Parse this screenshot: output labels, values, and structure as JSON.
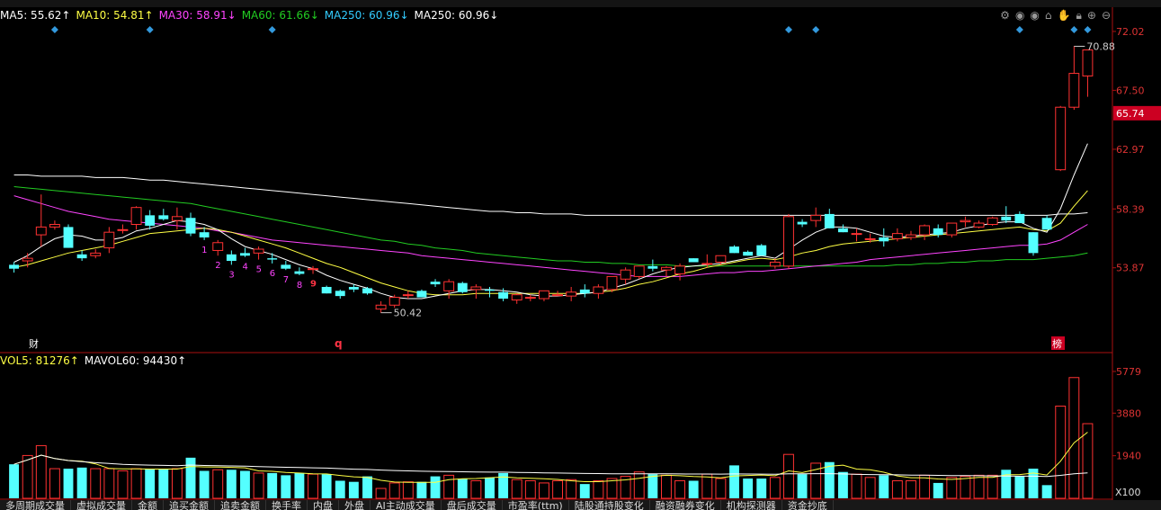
{
  "ma_legend": [
    {
      "label": "MA5: 55.62",
      "arrow": "↑",
      "color": "#ffffff"
    },
    {
      "label": "MA10: 54.81",
      "arrow": "↑",
      "color": "#ffff44"
    },
    {
      "label": "MA30: 58.91",
      "arrow": "↓",
      "color": "#ff44ff"
    },
    {
      "label": "MA60: 61.66",
      "arrow": "↓",
      "color": "#22cc22"
    },
    {
      "label": "MA250: 60.96",
      "arrow": "↓",
      "color": "#33ccff"
    },
    {
      "label": "MA250: 60.96",
      "arrow": "↓",
      "color": "#ffffff"
    }
  ],
  "vol_legend": [
    {
      "label": "VOL5: 81276",
      "arrow": "↑",
      "color": "#ffff44"
    },
    {
      "label": "MAVOL60: 94430",
      "arrow": "↑",
      "color": "#ffffff"
    }
  ],
  "toolbar_icons": [
    "gear-icon",
    "eye-icon",
    "eye-icon",
    "home-icon",
    "hand-icon",
    "lock-icon",
    "zoom-in-icon",
    "zoom-out-icon"
  ],
  "price_axis": {
    "ticks": [
      "72.02",
      "67.50",
      "62.97",
      "58.39",
      "53.87"
    ],
    "current": "65.74",
    "current_bg": "#cc0022"
  },
  "vol_axis": {
    "ticks": [
      "5779",
      "3880",
      "1940"
    ],
    "unit": "X100"
  },
  "annotations": {
    "high": "70.88",
    "low": "50.42",
    "cai": "财",
    "q": "q",
    "bang": "榜"
  },
  "td_counts": [
    "1",
    "2",
    "3",
    "4",
    "5",
    "6",
    "7",
    "8",
    "9"
  ],
  "bottom_tabs": [
    "多周期成交量",
    "虚拟成交量",
    "金额",
    "追买金额",
    "追卖金额",
    "换手率",
    "内盘",
    "外盘",
    "AI主动成交量",
    "盘后成交量",
    "市盈率(ttm)",
    "陆股通持股变化",
    "融资融券变化",
    "机构探测器",
    "资金抄底"
  ],
  "chart_data": {
    "type": "candlestick",
    "ylim": [
      48.6,
      72.5
    ],
    "ohlc": [
      [
        54.1,
        54.3,
        53.5,
        53.8
      ],
      [
        54.4,
        55.0,
        53.9,
        54.6
      ],
      [
        56.4,
        59.5,
        55.5,
        57.0
      ],
      [
        57.0,
        57.5,
        56.8,
        57.2
      ],
      [
        57.0,
        57.2,
        55.4,
        55.4
      ],
      [
        54.9,
        55.2,
        54.4,
        54.6
      ],
      [
        54.8,
        55.3,
        54.6,
        55.0
      ],
      [
        55.4,
        57.0,
        55.0,
        56.6
      ],
      [
        56.8,
        57.2,
        56.5,
        56.8
      ],
      [
        57.2,
        58.6,
        56.8,
        58.5
      ],
      [
        57.9,
        58.3,
        56.8,
        57.1
      ],
      [
        57.9,
        58.4,
        57.5,
        57.6
      ],
      [
        57.5,
        58.5,
        56.8,
        57.8
      ],
      [
        57.7,
        58.1,
        56.3,
        56.5
      ],
      [
        56.6,
        57.0,
        56.0,
        56.2
      ],
      [
        55.2,
        56.0,
        54.8,
        55.8
      ],
      [
        54.9,
        55.2,
        54.1,
        54.4
      ],
      [
        55.0,
        55.4,
        54.7,
        54.8
      ],
      [
        55.0,
        55.5,
        54.5,
        55.3
      ],
      [
        54.6,
        55.0,
        54.2,
        54.5
      ],
      [
        54.1,
        54.4,
        53.7,
        53.8
      ],
      [
        53.6,
        53.9,
        53.3,
        53.4
      ],
      [
        53.8,
        54.0,
        53.4,
        53.8
      ],
      [
        52.4,
        52.5,
        51.9,
        51.9
      ],
      [
        52.1,
        52.2,
        51.5,
        51.7
      ],
      [
        52.4,
        52.6,
        52.0,
        52.2
      ],
      [
        52.3,
        52.4,
        51.8,
        51.9
      ],
      [
        50.7,
        51.3,
        50.4,
        51.0
      ],
      [
        51.0,
        51.8,
        50.8,
        51.6
      ],
      [
        51.8,
        52.1,
        51.5,
        51.8
      ],
      [
        52.1,
        52.2,
        51.6,
        51.6
      ],
      [
        52.8,
        53.0,
        52.4,
        52.6
      ],
      [
        52.1,
        53.0,
        51.5,
        52.8
      ],
      [
        52.7,
        52.8,
        51.9,
        52.0
      ],
      [
        52.2,
        52.6,
        51.5,
        52.4
      ],
      [
        52.2,
        52.4,
        51.6,
        52.1
      ],
      [
        52.0,
        52.3,
        51.3,
        51.5
      ],
      [
        51.4,
        51.9,
        51.1,
        51.8
      ],
      [
        51.6,
        51.8,
        51.3,
        51.6
      ],
      [
        51.5,
        52.1,
        51.3,
        52.1
      ],
      [
        51.8,
        52.1,
        51.7,
        51.8
      ],
      [
        51.7,
        52.4,
        51.3,
        52.0
      ],
      [
        52.2,
        52.6,
        51.6,
        51.9
      ],
      [
        51.9,
        52.6,
        51.5,
        52.4
      ],
      [
        52.2,
        53.2,
        52.0,
        53.2
      ],
      [
        53.0,
        53.9,
        52.6,
        53.7
      ],
      [
        53.2,
        54.0,
        53.0,
        54.0
      ],
      [
        54.0,
        54.5,
        53.6,
        53.8
      ],
      [
        53.7,
        54.0,
        53.2,
        53.9
      ],
      [
        53.4,
        54.2,
        52.9,
        54.0
      ],
      [
        54.6,
        54.6,
        54.3,
        54.3
      ],
      [
        54.2,
        54.9,
        53.9,
        54.2
      ],
      [
        54.3,
        54.8,
        54.1,
        54.8
      ],
      [
        55.5,
        55.6,
        55.0,
        55.0
      ],
      [
        55.1,
        55.2,
        54.8,
        54.8
      ],
      [
        55.6,
        55.7,
        54.9,
        54.8
      ],
      [
        54.0,
        54.6,
        53.8,
        54.3
      ],
      [
        54.0,
        58.0,
        53.8,
        57.8
      ],
      [
        57.4,
        57.6,
        57.0,
        57.2
      ],
      [
        57.5,
        58.5,
        57.0,
        57.9
      ],
      [
        58.0,
        58.4,
        56.9,
        56.9
      ],
      [
        56.9,
        57.2,
        56.6,
        56.6
      ],
      [
        56.5,
        56.9,
        55.9,
        56.5
      ],
      [
        56.1,
        56.5,
        55.8,
        56.1
      ],
      [
        56.2,
        56.9,
        55.5,
        55.9
      ],
      [
        56.1,
        56.9,
        55.9,
        56.5
      ],
      [
        56.2,
        56.7,
        56.0,
        56.4
      ],
      [
        56.4,
        57.2,
        56.0,
        57.1
      ],
      [
        56.9,
        57.2,
        56.2,
        56.4
      ],
      [
        56.4,
        57.3,
        56.2,
        57.3
      ],
      [
        57.4,
        57.8,
        57.0,
        57.5
      ],
      [
        57.0,
        57.5,
        56.9,
        57.3
      ],
      [
        57.2,
        57.8,
        57.1,
        57.7
      ],
      [
        57.8,
        58.6,
        57.3,
        57.5
      ],
      [
        58.0,
        58.2,
        57.3,
        57.3
      ],
      [
        56.6,
        56.6,
        54.8,
        55.0
      ],
      [
        57.7,
        57.9,
        56.8,
        56.8
      ],
      [
        61.4,
        66.3,
        61.3,
        66.2
      ],
      [
        66.2,
        70.9,
        66.0,
        68.8
      ],
      [
        68.6,
        70.6,
        67.0,
        70.6
      ]
    ],
    "ma5": [
      54.3,
      54.8,
      55.5,
      56.1,
      56.4,
      56.3,
      56.0,
      56.0,
      56.2,
      56.7,
      56.9,
      57.2,
      57.5,
      57.4,
      57.2,
      56.8,
      56.1,
      55.5,
      55.2,
      54.9,
      54.5,
      54.1,
      53.8,
      53.3,
      52.9,
      52.6,
      52.3,
      51.9,
      51.6,
      51.5,
      51.5,
      51.7,
      51.9,
      52.1,
      52.2,
      52.2,
      52.1,
      52.0,
      51.8,
      51.7,
      51.7,
      51.8,
      51.9,
      52.0,
      52.3,
      52.6,
      53.0,
      53.4,
      53.7,
      53.9,
      54.0,
      54.1,
      54.2,
      54.4,
      54.6,
      54.8,
      54.6,
      55.3,
      56.0,
      56.6,
      57.0,
      57.0,
      56.9,
      56.6,
      56.3,
      56.2,
      56.3,
      56.4,
      56.5,
      56.6,
      56.9,
      57.1,
      57.3,
      57.4,
      57.4,
      56.9,
      56.6,
      58.4,
      61.0,
      63.4
    ],
    "ma10": [
      53.9,
      54.1,
      54.4,
      54.7,
      55.0,
      55.2,
      55.4,
      55.6,
      55.9,
      56.2,
      56.5,
      56.6,
      56.7,
      56.8,
      56.9,
      56.8,
      56.6,
      56.3,
      56.0,
      55.7,
      55.4,
      55.0,
      54.6,
      54.2,
      53.9,
      53.5,
      53.1,
      52.7,
      52.4,
      52.1,
      51.9,
      51.8,
      51.8,
      51.8,
      51.9,
      51.9,
      51.9,
      51.9,
      51.9,
      51.9,
      51.9,
      51.9,
      51.9,
      52.0,
      52.1,
      52.3,
      52.6,
      52.8,
      53.1,
      53.4,
      53.6,
      53.9,
      54.1,
      54.3,
      54.5,
      54.6,
      54.5,
      54.7,
      55.0,
      55.2,
      55.5,
      55.7,
      55.8,
      55.9,
      56.0,
      56.1,
      56.2,
      56.3,
      56.4,
      56.5,
      56.6,
      56.7,
      56.8,
      56.9,
      57.0,
      56.8,
      56.7,
      57.3,
      58.6,
      59.8
    ],
    "ma30": [
      59.4,
      59.1,
      58.8,
      58.5,
      58.2,
      58.0,
      57.8,
      57.6,
      57.5,
      57.4,
      57.3,
      57.2,
      57.1,
      57.0,
      56.9,
      56.7,
      56.6,
      56.4,
      56.2,
      56.0,
      55.9,
      55.8,
      55.7,
      55.6,
      55.5,
      55.4,
      55.3,
      55.2,
      55.1,
      55.0,
      54.8,
      54.7,
      54.6,
      54.5,
      54.4,
      54.3,
      54.2,
      54.1,
      54.0,
      53.9,
      53.8,
      53.7,
      53.6,
      53.5,
      53.4,
      53.3,
      53.2,
      53.2,
      53.2,
      53.2,
      53.3,
      53.4,
      53.5,
      53.5,
      53.6,
      53.6,
      53.7,
      53.8,
      53.9,
      54.0,
      54.1,
      54.2,
      54.3,
      54.5,
      54.6,
      54.7,
      54.8,
      54.9,
      55.0,
      55.1,
      55.2,
      55.3,
      55.4,
      55.5,
      55.6,
      55.6,
      55.7,
      56.0,
      56.6,
      57.2
    ],
    "ma60": [
      60.1,
      60.0,
      59.9,
      59.8,
      59.7,
      59.6,
      59.5,
      59.4,
      59.3,
      59.2,
      59.1,
      59.0,
      58.9,
      58.8,
      58.6,
      58.4,
      58.2,
      58.0,
      57.8,
      57.6,
      57.4,
      57.2,
      57.0,
      56.8,
      56.6,
      56.4,
      56.2,
      56.0,
      55.9,
      55.7,
      55.6,
      55.4,
      55.3,
      55.2,
      55.0,
      54.9,
      54.8,
      54.7,
      54.6,
      54.5,
      54.4,
      54.4,
      54.3,
      54.3,
      54.2,
      54.2,
      54.1,
      54.1,
      54.1,
      54.0,
      54.0,
      54.0,
      54.0,
      54.0,
      54.0,
      54.0,
      54.0,
      54.0,
      54.0,
      54.0,
      54.0,
      54.0,
      54.0,
      54.0,
      54.0,
      54.1,
      54.1,
      54.2,
      54.2,
      54.3,
      54.3,
      54.4,
      54.4,
      54.5,
      54.5,
      54.5,
      54.6,
      54.7,
      54.8,
      55.0
    ],
    "ma250": [
      61.0,
      61.0,
      60.9,
      60.9,
      60.9,
      60.9,
      60.8,
      60.8,
      60.8,
      60.7,
      60.6,
      60.6,
      60.5,
      60.4,
      60.3,
      60.2,
      60.1,
      60.0,
      59.9,
      59.8,
      59.7,
      59.6,
      59.5,
      59.4,
      59.3,
      59.2,
      59.1,
      59.0,
      58.9,
      58.8,
      58.7,
      58.6,
      58.5,
      58.4,
      58.3,
      58.2,
      58.2,
      58.1,
      58.1,
      58.0,
      58.0,
      58.0,
      57.9,
      57.9,
      57.9,
      57.9,
      57.9,
      57.9,
      57.9,
      57.9,
      57.9,
      57.9,
      57.9,
      57.9,
      57.9,
      57.9,
      57.9,
      57.9,
      57.9,
      57.9,
      57.9,
      57.9,
      57.9,
      57.9,
      57.9,
      57.9,
      57.9,
      57.9,
      57.9,
      57.9,
      57.9,
      57.9,
      57.9,
      57.9,
      57.9,
      57.9,
      57.9,
      58.0,
      58.0,
      58.1
    ],
    "volume": [
      1550,
      1950,
      2400,
      1350,
      1350,
      1400,
      1350,
      1350,
      1250,
      1350,
      1350,
      1350,
      1350,
      1850,
      1250,
      1300,
      1300,
      1250,
      1150,
      1150,
      1050,
      1150,
      1100,
      1100,
      800,
      750,
      1000,
      450,
      700,
      750,
      750,
      1000,
      1050,
      900,
      800,
      950,
      1150,
      850,
      800,
      700,
      800,
      850,
      650,
      800,
      900,
      1000,
      1200,
      1100,
      1050,
      800,
      800,
      1100,
      900,
      1500,
      900,
      900,
      950,
      2000,
      1100,
      1600,
      1650,
      1200,
      1100,
      950,
      1050,
      800,
      800,
      1050,
      700,
      950,
      1000,
      1050,
      1050,
      1300,
      1000,
      1350,
      600,
      4200,
      5500,
      3400
    ],
    "vol_ylim": [
      0,
      5900
    ],
    "markers_top_x": [
      3,
      10,
      19,
      57,
      59,
      74,
      78,
      79
    ],
    "td_sequence_start": 14
  }
}
